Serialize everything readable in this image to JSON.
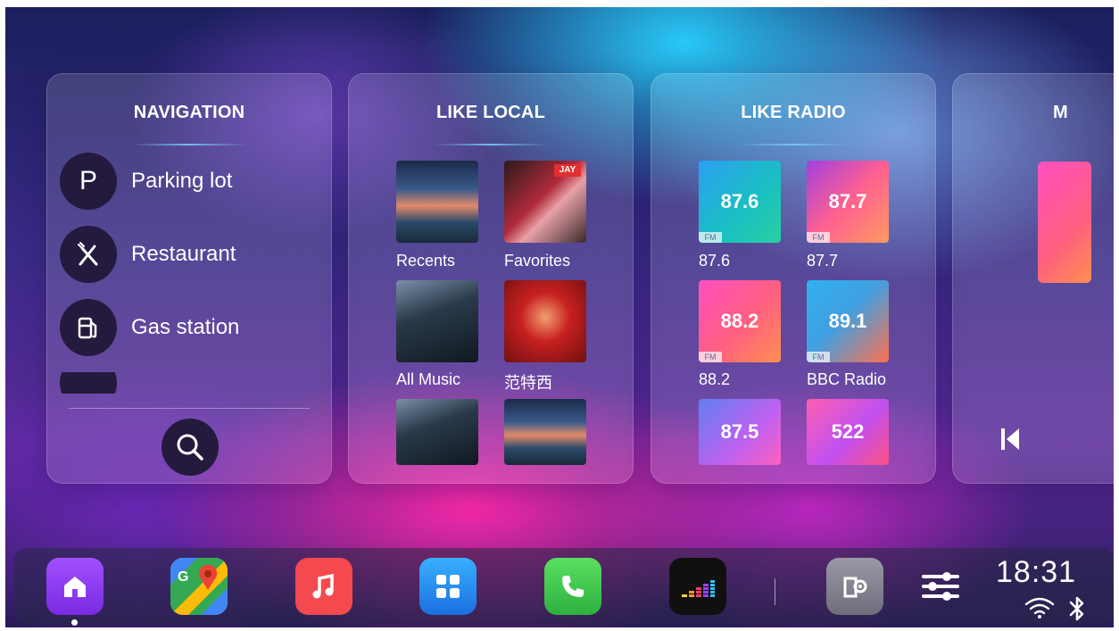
{
  "cards": {
    "navigation": {
      "title": "NAVIGATION",
      "items": [
        {
          "icon": "parking-icon",
          "icon_glyph": "P",
          "label": "Parking lot"
        },
        {
          "icon": "restaurant-icon",
          "label": "Restaurant"
        },
        {
          "icon": "gas-station-icon",
          "label": "Gas station"
        }
      ]
    },
    "like_local": {
      "title": "LIKE LOCAL",
      "items": [
        {
          "label": "Recents"
        },
        {
          "label": "Favorites"
        },
        {
          "label": "All Music"
        },
        {
          "label": "范特西"
        }
      ]
    },
    "like_radio": {
      "title": "LIKE RADIO",
      "items": [
        {
          "frequency": "87.6",
          "label": "87.6",
          "badge": "FM"
        },
        {
          "frequency": "87.7",
          "label": "87.7",
          "badge": "FM"
        },
        {
          "frequency": "88.2",
          "label": "88.2",
          "badge": "FM"
        },
        {
          "frequency": "89.1",
          "label": "BBC Radio",
          "badge": "FM"
        },
        {
          "frequency": "87.5"
        },
        {
          "frequency": "522"
        }
      ]
    },
    "partial": {
      "title": "M"
    }
  },
  "dock": {
    "apps": [
      {
        "name": "home",
        "icon": "home-icon",
        "active": true
      },
      {
        "name": "maps",
        "icon": "google-maps-icon"
      },
      {
        "name": "music",
        "icon": "music-note-icon"
      },
      {
        "name": "apps",
        "icon": "app-grid-icon"
      },
      {
        "name": "phone",
        "icon": "phone-icon"
      },
      {
        "name": "deezer",
        "icon": "deezer-equalizer-icon"
      },
      {
        "name": "car-settings",
        "icon": "car-settings-icon"
      },
      {
        "name": "settings",
        "icon": "sliders-icon"
      }
    ],
    "clock": "18:31",
    "status_icons": [
      "wifi-icon",
      "bluetooth-icon"
    ]
  },
  "colors": {
    "home_icon_bg": "#8e3cf0",
    "music_icon_bg": "#f4494f",
    "apps_icon_bg": "#2f8fef",
    "phone_icon_bg": "#48c84a"
  }
}
